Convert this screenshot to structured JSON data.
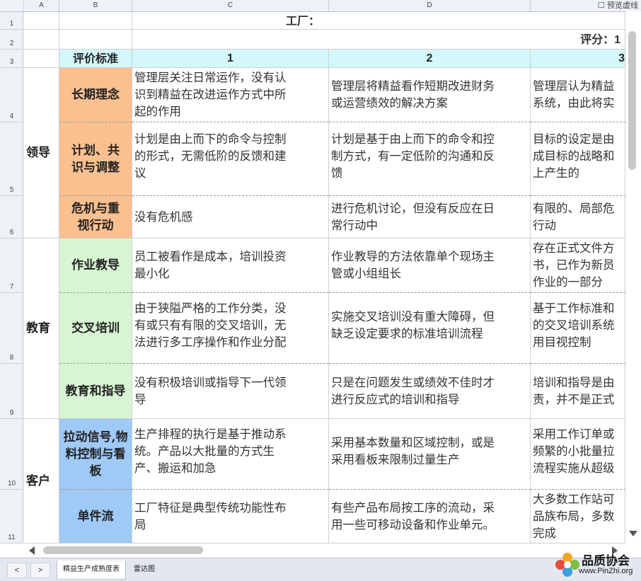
{
  "toolbar": {
    "preview_label": "预览虚线"
  },
  "columns": [
    "A",
    "B",
    "C",
    "D"
  ],
  "rows": [
    "1",
    "2",
    "3",
    "4",
    "5",
    "6",
    "7",
    "8",
    "9",
    "10",
    "11"
  ],
  "header": {
    "factory_label": "工厂：",
    "score_label": "评分：1",
    "criteria_label": "评价标准",
    "level1": "1",
    "level2": "2",
    "level3": "3"
  },
  "categories": [
    {
      "label": "领导"
    },
    {
      "label": "教育"
    },
    {
      "label": "客户"
    }
  ],
  "criteria": [
    {
      "name": "长期理念",
      "color": "#fac08f",
      "l1": [
        "管理层关注日常运作，没有认",
        "识到精益在改进运作方式中所",
        "起的作用"
      ],
      "l2": [
        "管理层将精益看作短期改进财务",
        "或运营绩效的解决方案"
      ],
      "l3": [
        "管理层认为精益",
        "系统，由此将实"
      ]
    },
    {
      "name": "计划、共识与调整",
      "color": "#fac08f",
      "l1": [
        "计划是由上而下的命令与控制",
        "的形式，无需低阶的反馈和建",
        "议"
      ],
      "l2": [
        "计划是基于由上而下的命令和控",
        "制方式，有一定低阶的沟通和反",
        "馈"
      ],
      "l3": [
        "目标的设定是由",
        "成目标的战略和",
        "上产生的"
      ]
    },
    {
      "name": "危机与重视行动",
      "color": "#fac08f",
      "l1": [
        "没有危机感"
      ],
      "l2": [
        "进行危机讨论，但没有反应在日",
        "常行动中"
      ],
      "l3": [
        "有限的、局部危",
        "行动"
      ]
    },
    {
      "name": "作业教导",
      "color": "#d7f5d2",
      "l1": [
        "员工被看作是成本，培训投资",
        "最小化"
      ],
      "l2": [
        "作业教导的方法依靠单个现场主",
        "管或小组组长"
      ],
      "l3": [
        "存在正式文件方",
        "书，已作为新员",
        "作业的一部分"
      ]
    },
    {
      "name": "交叉培训",
      "color": "#d7f5d2",
      "l1": [
        "由于狭隘严格的工作分类，没",
        "有或只有有限的交叉培训，无",
        "法进行多工序操作和作业分配"
      ],
      "l2": [
        "实施交叉培训没有重大障碍，但",
        "缺乏设定要求的标准培训流程"
      ],
      "l3": [
        "基于工作标准和",
        "的交叉培训系统",
        "用目视控制"
      ]
    },
    {
      "name": "教育和指导",
      "color": "#d7f5d2",
      "l1": [
        "没有积极培训或指导下一代领",
        "导"
      ],
      "l2": [
        "只是在问题发生或绩效不佳时才",
        "进行反应式的培训和指导"
      ],
      "l3": [
        "培训和指导是由",
        "责，并不是正式"
      ]
    },
    {
      "name": "拉动信号,物料控制与看板",
      "color": "#9fc9f7",
      "l1": [
        "生产排程的执行是基于推动系",
        "统。产品以大批量的方式生",
        "产、搬运和加急"
      ],
      "l2": [
        "采用基本数量和区域控制，或是",
        "采用看板来限制过量生产"
      ],
      "l3": [
        "采用工作订单或",
        "频繁的小批量拉",
        "流程实施从超级"
      ]
    },
    {
      "name": "单件流",
      "color": "#9fc9f7",
      "l1": [
        "工厂特征是典型传统功能性布",
        "局"
      ],
      "l2": [
        "有些产品布局按工序的流动，采",
        "用一些可移动设备和作业单元。"
      ],
      "l3": [
        "大多数工作站可",
        "品族布局，多数",
        "完成"
      ]
    }
  ],
  "sheet_nav": {
    "prev": "<",
    "next": ">"
  },
  "tabs": [
    {
      "label": "精益生产成熟度表",
      "active": true
    },
    {
      "label": "雷达图",
      "active": false
    }
  ],
  "watermark": {
    "title": "品质协会",
    "url": "www.PinZhi.org"
  }
}
